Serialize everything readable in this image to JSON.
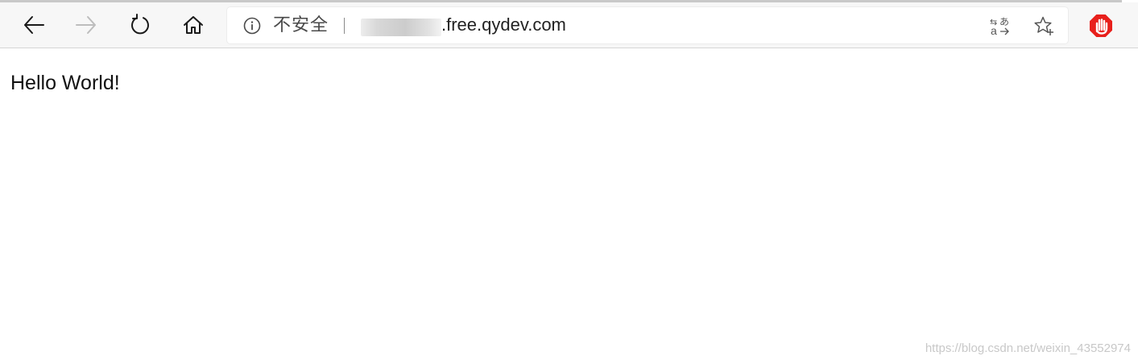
{
  "toolbar": {
    "back_icon": "arrow-left-icon",
    "forward_icon": "arrow-right-icon",
    "refresh_icon": "refresh-icon",
    "home_icon": "home-icon"
  },
  "address_bar": {
    "security_icon": "info-icon",
    "security_label": "不安全",
    "url_visible": ".free.qydev.com",
    "translate_icon": "translate-icon",
    "favorite_icon": "star-plus-icon"
  },
  "extension": {
    "icon": "adblock-stop-hand-icon",
    "color": "#e8201c"
  },
  "page": {
    "heading": "Hello World!"
  },
  "watermark": {
    "text": "https://blog.csdn.net/weixin_43552974"
  },
  "colors": {
    "toolbar_bg": "#f7f7f7",
    "disabled_icon": "#bdbdbd",
    "icon": "#1a1a1a"
  }
}
